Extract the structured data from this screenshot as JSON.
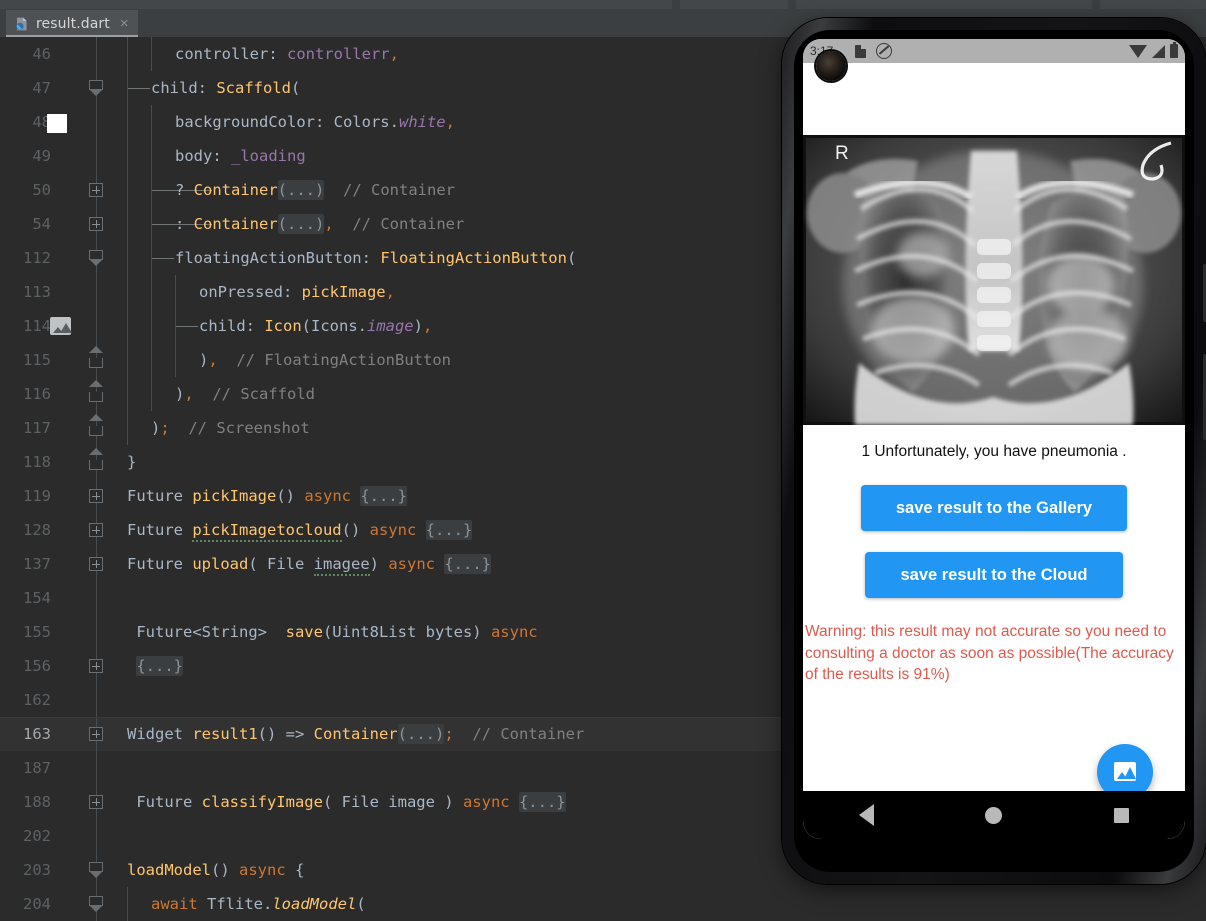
{
  "ide": {
    "tab": {
      "filename": "result.dart",
      "close_glyph": "×",
      "icon": "dart-file-icon"
    },
    "theme": {
      "background": "#2b2b2b",
      "gutter_text": "#5d6163",
      "current_line_bg": "#323232"
    },
    "lines": [
      {
        "num": "46",
        "fold": "",
        "marker": "",
        "indent": 2,
        "tokens": [
          {
            "t": "controller: ",
            "c": "c-plain"
          },
          {
            "t": "controllerr",
            "c": "c-fld"
          },
          {
            "t": ",",
            "c": "c-kw"
          }
        ]
      },
      {
        "num": "47",
        "fold": "chev-down",
        "marker": "",
        "indent": 1,
        "tree": 1,
        "tokens": [
          {
            "t": "child: ",
            "c": "c-plain"
          },
          {
            "t": "Scaffold",
            "c": "c-cls"
          },
          {
            "t": "(",
            "c": "c-plain"
          }
        ]
      },
      {
        "num": "48",
        "fold": "",
        "marker": "color-swatch-white",
        "indent": 2,
        "tokens": [
          {
            "t": "backgroundColor: ",
            "c": "c-plain"
          },
          {
            "t": "Colors",
            "c": "c-plain"
          },
          {
            "t": ".",
            "c": "c-plain"
          },
          {
            "t": "white",
            "c": "c-fld c-ital"
          },
          {
            "t": ",",
            "c": "c-kw"
          }
        ]
      },
      {
        "num": "49",
        "fold": "",
        "marker": "",
        "indent": 2,
        "tokens": [
          {
            "t": "body: ",
            "c": "c-plain"
          },
          {
            "t": "_loading",
            "c": "c-fld"
          }
        ]
      },
      {
        "num": "50",
        "fold": "plus",
        "marker": "",
        "indent": 2,
        "tree": 2,
        "tokens": [
          {
            "t": "? ",
            "c": "c-plain"
          },
          {
            "t": "Container",
            "c": "c-cls"
          },
          {
            "t": "(...)",
            "c": "folded"
          },
          {
            "t": "  // Container",
            "c": "c-com"
          }
        ]
      },
      {
        "num": "54",
        "fold": "plus",
        "marker": "",
        "indent": 2,
        "tree": 2,
        "tokens": [
          {
            "t": ": ",
            "c": "c-plain"
          },
          {
            "t": "Container",
            "c": "c-cls"
          },
          {
            "t": "(...)",
            "c": "folded"
          },
          {
            "t": ",",
            "c": "c-kw"
          },
          {
            "t": "  // Container",
            "c": "c-com"
          }
        ]
      },
      {
        "num": "112",
        "fold": "chev-down",
        "marker": "",
        "indent": 2,
        "tree": 1,
        "tokens": [
          {
            "t": "floatingActionButton: ",
            "c": "c-plain"
          },
          {
            "t": "FloatingActionButton",
            "c": "c-cls"
          },
          {
            "t": "(",
            "c": "c-plain"
          }
        ]
      },
      {
        "num": "113",
        "fold": "",
        "marker": "",
        "indent": 3,
        "tokens": [
          {
            "t": "onPressed: ",
            "c": "c-plain"
          },
          {
            "t": "pickImage",
            "c": "c-fn"
          },
          {
            "t": ",",
            "c": "c-kw"
          }
        ]
      },
      {
        "num": "114",
        "fold": "",
        "marker": "image-icon",
        "indent": 3,
        "tree": 1,
        "tokens": [
          {
            "t": "child: ",
            "c": "c-plain"
          },
          {
            "t": "Icon",
            "c": "c-cls"
          },
          {
            "t": "(Icons.",
            "c": "c-plain"
          },
          {
            "t": "image",
            "c": "c-fld c-ital"
          },
          {
            "t": ")",
            "c": "c-plain"
          },
          {
            "t": ",",
            "c": "c-kw"
          }
        ]
      },
      {
        "num": "115",
        "fold": "chev-up",
        "marker": "",
        "indent": 3,
        "tokens": [
          {
            "t": ")",
            "c": "c-plain"
          },
          {
            "t": ",",
            "c": "c-kw"
          },
          {
            "t": "  // FloatingActionButton",
            "c": "c-com"
          }
        ]
      },
      {
        "num": "116",
        "fold": "chev-up",
        "marker": "",
        "indent": 2,
        "tokens": [
          {
            "t": ")",
            "c": "c-plain"
          },
          {
            "t": ",",
            "c": "c-kw"
          },
          {
            "t": "  // Scaffold",
            "c": "c-com"
          }
        ]
      },
      {
        "num": "117",
        "fold": "chev-up",
        "marker": "",
        "indent": 1,
        "tokens": [
          {
            "t": ")",
            "c": "c-plain"
          },
          {
            "t": ";",
            "c": "c-kw"
          },
          {
            "t": "  // Screenshot",
            "c": "c-com"
          }
        ]
      },
      {
        "num": "118",
        "fold": "chev-up",
        "marker": "",
        "indent": 0,
        "tokens": [
          {
            "t": "}",
            "c": "c-plain"
          }
        ]
      },
      {
        "num": "119",
        "fold": "plus",
        "marker": "",
        "indent": 0,
        "tokens": [
          {
            "t": "Future ",
            "c": "c-plain"
          },
          {
            "t": "pickImage",
            "c": "c-fn"
          },
          {
            "t": "() ",
            "c": "c-plain"
          },
          {
            "t": "async ",
            "c": "c-kw"
          },
          {
            "t": "{...}",
            "c": "folded"
          }
        ]
      },
      {
        "num": "128",
        "fold": "plus",
        "marker": "",
        "indent": 0,
        "tokens": [
          {
            "t": "Future ",
            "c": "c-plain"
          },
          {
            "t": "pickImagetocloud",
            "c": "c-fn squig"
          },
          {
            "t": "() ",
            "c": "c-plain"
          },
          {
            "t": "async ",
            "c": "c-kw"
          },
          {
            "t": "{...}",
            "c": "folded"
          }
        ]
      },
      {
        "num": "137",
        "fold": "plus",
        "marker": "",
        "indent": 0,
        "tokens": [
          {
            "t": "Future ",
            "c": "c-plain"
          },
          {
            "t": "upload",
            "c": "c-fn"
          },
          {
            "t": "( File ",
            "c": "c-plain"
          },
          {
            "t": "imagee",
            "c": "c-plain squig"
          },
          {
            "t": ") ",
            "c": "c-plain"
          },
          {
            "t": "async ",
            "c": "c-kw"
          },
          {
            "t": "{...}",
            "c": "folded"
          }
        ]
      },
      {
        "num": "154",
        "fold": "",
        "marker": "",
        "indent": 0,
        "tokens": []
      },
      {
        "num": "155",
        "fold": "",
        "marker": "",
        "indent": 0,
        "tokens": [
          {
            "t": " Future<String>  ",
            "c": "c-plain"
          },
          {
            "t": "save",
            "c": "c-fn"
          },
          {
            "t": "(Uint8List bytes) ",
            "c": "c-plain"
          },
          {
            "t": "async",
            "c": "c-kw"
          }
        ]
      },
      {
        "num": "156",
        "fold": "plus",
        "marker": "",
        "indent": 0,
        "tokens": [
          {
            "t": " ",
            "c": "c-plain"
          },
          {
            "t": "{...}",
            "c": "folded"
          }
        ]
      },
      {
        "num": "162",
        "fold": "",
        "marker": "",
        "indent": 0,
        "tokens": []
      },
      {
        "num": "163",
        "fold": "plus",
        "marker": "",
        "indent": 0,
        "current": true,
        "tokens": [
          {
            "t": "Widget ",
            "c": "c-plain"
          },
          {
            "t": "result1",
            "c": "c-fn"
          },
          {
            "t": "() => ",
            "c": "c-plain"
          },
          {
            "t": "Container",
            "c": "c-cls"
          },
          {
            "t": "(...)",
            "c": "folded"
          },
          {
            "t": ";",
            "c": "c-kw"
          },
          {
            "t": "  // Container",
            "c": "c-com"
          }
        ]
      },
      {
        "num": "187",
        "fold": "",
        "marker": "",
        "indent": 0,
        "tokens": []
      },
      {
        "num": "188",
        "fold": "plus",
        "marker": "",
        "indent": 0,
        "tokens": [
          {
            "t": " Future ",
            "c": "c-plain"
          },
          {
            "t": "classifyImage",
            "c": "c-fn"
          },
          {
            "t": "( File image ) ",
            "c": "c-plain"
          },
          {
            "t": "async ",
            "c": "c-kw"
          },
          {
            "t": "{...}",
            "c": "folded"
          }
        ]
      },
      {
        "num": "202",
        "fold": "",
        "marker": "",
        "indent": 0,
        "tokens": []
      },
      {
        "num": "203",
        "fold": "chev-down",
        "marker": "",
        "indent": 0,
        "tokens": [
          {
            "t": "loadModel",
            "c": "c-fn"
          },
          {
            "t": "() ",
            "c": "c-plain"
          },
          {
            "t": "async ",
            "c": "c-kw"
          },
          {
            "t": "{",
            "c": "c-plain"
          }
        ]
      },
      {
        "num": "204",
        "fold": "chev-down",
        "marker": "",
        "indent": 1,
        "tokens": [
          {
            "t": "await ",
            "c": "c-kw"
          },
          {
            "t": "Tflite.",
            "c": "c-plain"
          },
          {
            "t": "loadModel",
            "c": "c-fn c-ital"
          },
          {
            "t": "(",
            "c": "c-plain"
          }
        ]
      }
    ]
  },
  "phone": {
    "status_bar": {
      "time": "3:17",
      "icons": [
        "sd-card-icon",
        "do-not-disturb-icon",
        "wifi-icon",
        "cellular-signal-icon",
        "battery-icon"
      ]
    },
    "app": {
      "xray_marker": "R",
      "result_text": "1 Unfortunately, you have pneumonia .",
      "buttons": [
        {
          "label": "save result to the Gallery",
          "name": "save-to-gallery-button"
        },
        {
          "label": "save result to the Cloud",
          "name": "save-to-cloud-button"
        }
      ],
      "warning_text": "Warning: this result may not accurate so you need to consulting a doctor as soon as possible(The accuracy of the results is 91%)",
      "accuracy": "91%",
      "fab_icon": "image-icon",
      "colors": {
        "button": "#2196f3",
        "warning": "#e2584d",
        "background": "#ffffff"
      }
    },
    "nav_bar": {
      "items": [
        "back-icon",
        "home-icon",
        "recents-icon"
      ]
    }
  }
}
